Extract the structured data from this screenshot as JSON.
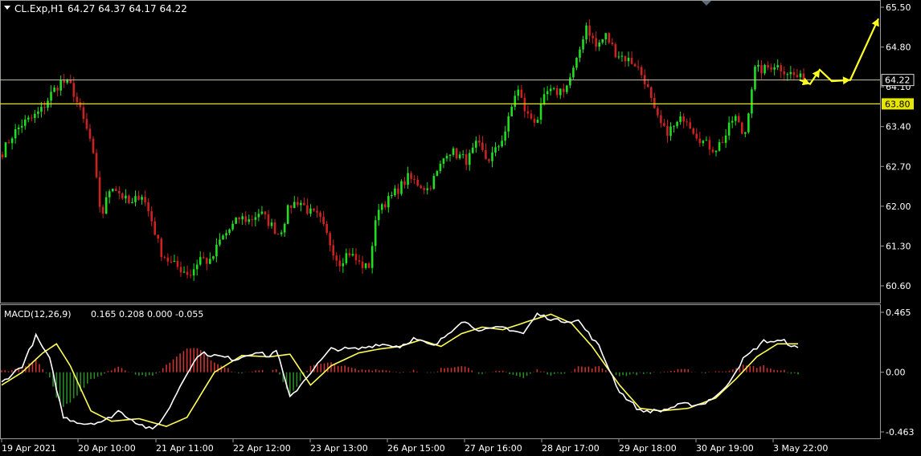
{
  "header": {
    "symbol": "CL.Exp,H1",
    "ohlc": "64.27 64.37 64.17 64.22"
  },
  "colors": {
    "background": "#000000",
    "bull_candle": "#22dd22",
    "bear_candle": "#cc2222",
    "level_line": "#e6e600",
    "current_price_line": "#c8c8a0",
    "macd_line": "#ffffff",
    "signal_line": "#ffff55",
    "hist_pos": "#cc3333",
    "hist_neg": "#2a8a2a",
    "axis_text": "#ffffff"
  },
  "chart_data": [
    {
      "type": "candlestick",
      "timeframe": "H1",
      "ylim": [
        60.3,
        65.55
      ],
      "y_ticks": [
        "65.50",
        "64.80",
        "64.10",
        "63.40",
        "62.70",
        "62.00",
        "61.30",
        "60.60"
      ],
      "x_ticks": [
        "19 Apr 2021",
        "20 Apr 10:00",
        "21 Apr 11:00",
        "22 Apr 12:00",
        "23 Apr 13:00",
        "26 Apr 15:00",
        "27 Apr 16:00",
        "28 Apr 17:00",
        "29 Apr 18:00",
        "30 Apr 19:00",
        "3 May 22:00"
      ],
      "current_price": {
        "value": 64.22,
        "label": "64.22"
      },
      "horizontal_level": {
        "value": 63.8,
        "label": "63.80"
      },
      "close_anchors": [
        [
          0,
          62.95
        ],
        [
          1,
          63.25
        ],
        [
          2,
          63.45
        ],
        [
          3,
          63.55
        ],
        [
          4,
          63.7
        ],
        [
          5,
          64.0
        ],
        [
          6,
          64.2
        ],
        [
          7,
          64.1
        ],
        [
          8,
          63.6
        ],
        [
          9,
          63.1
        ],
        [
          10,
          61.8
        ],
        [
          11,
          62.4
        ],
        [
          12,
          62.2
        ],
        [
          13,
          62.0
        ],
        [
          14,
          62.25
        ],
        [
          15,
          61.8
        ],
        [
          16,
          61.2
        ],
        [
          17,
          61.0
        ],
        [
          18,
          60.9
        ],
        [
          19,
          60.8
        ],
        [
          20,
          61.1
        ],
        [
          21,
          61.0
        ],
        [
          22,
          61.4
        ],
        [
          23,
          61.6
        ],
        [
          24,
          61.8
        ],
        [
          25,
          61.75
        ],
        [
          26,
          61.9
        ],
        [
          27,
          61.7
        ],
        [
          28,
          61.5
        ],
        [
          29,
          62.0
        ],
        [
          30,
          62.1
        ],
        [
          31,
          61.9
        ],
        [
          32,
          61.8
        ],
        [
          33,
          61.4
        ],
        [
          34,
          61.0
        ],
        [
          35,
          61.2
        ],
        [
          36,
          61.0
        ],
        [
          37,
          60.9
        ],
        [
          38,
          62.0
        ],
        [
          39,
          62.1
        ],
        [
          40,
          62.3
        ],
        [
          41,
          62.5
        ],
        [
          42,
          62.4
        ],
        [
          43,
          62.3
        ],
        [
          44,
          62.6
        ],
        [
          45,
          63.0
        ],
        [
          46,
          62.9
        ],
        [
          47,
          62.8
        ],
        [
          48,
          63.1
        ],
        [
          49,
          62.8
        ],
        [
          50,
          63.0
        ],
        [
          51,
          63.4
        ],
        [
          52,
          64.1
        ],
        [
          53,
          63.6
        ],
        [
          54,
          63.5
        ],
        [
          55,
          64.0
        ],
        [
          56,
          64.0
        ],
        [
          57,
          64.1
        ],
        [
          58,
          64.5
        ],
        [
          59,
          65.2
        ],
        [
          60,
          64.8
        ],
        [
          61,
          65.0
        ],
        [
          62,
          64.7
        ],
        [
          63,
          64.6
        ],
        [
          64,
          64.5
        ],
        [
          65,
          64.2
        ],
        [
          66,
          63.6
        ],
        [
          67,
          63.3
        ],
        [
          68,
          63.4
        ],
        [
          69,
          63.6
        ],
        [
          70,
          63.3
        ],
        [
          71,
          63.1
        ],
        [
          72,
          63.0
        ],
        [
          73,
          63.2
        ],
        [
          74,
          63.6
        ],
        [
          75,
          63.2
        ],
        [
          76,
          64.4
        ],
        [
          77,
          64.4
        ],
        [
          78,
          64.5
        ],
        [
          79,
          64.4
        ],
        [
          80,
          64.3
        ],
        [
          81,
          64.22
        ]
      ],
      "projection_arrow_path": [
        [
          64.22,
          0
        ],
        [
          64.15,
          1
        ],
        [
          64.4,
          2
        ],
        [
          64.2,
          3
        ],
        [
          64.22,
          4
        ],
        [
          65.3,
          5
        ]
      ]
    },
    {
      "type": "macd",
      "title": "MACD(12,26,9)",
      "values": "0.165 0.208 0.000 -0.055",
      "ylim": [
        -0.463,
        0.465
      ],
      "y_ticks": [
        "0.465",
        "0.00",
        "-0.463"
      ],
      "macd_anchors": [
        [
          0,
          -0.08
        ],
        [
          6,
          0.05
        ],
        [
          10,
          0.28
        ],
        [
          14,
          0.1
        ],
        [
          18,
          -0.35
        ],
        [
          24,
          -0.4
        ],
        [
          30,
          -0.38
        ],
        [
          34,
          -0.3
        ],
        [
          40,
          -0.4
        ],
        [
          44,
          -0.45
        ],
        [
          48,
          -0.32
        ],
        [
          54,
          0.0
        ],
        [
          58,
          0.15
        ],
        [
          64,
          0.12
        ],
        [
          68,
          0.1
        ],
        [
          74,
          0.16
        ],
        [
          78,
          0.12
        ],
        [
          80,
          0.18
        ],
        [
          84,
          -0.2
        ],
        [
          90,
          0.0
        ],
        [
          96,
          0.18
        ],
        [
          104,
          0.18
        ],
        [
          110,
          0.22
        ],
        [
          116,
          0.2
        ],
        [
          120,
          0.26
        ],
        [
          126,
          0.2
        ],
        [
          134,
          0.4
        ],
        [
          140,
          0.32
        ],
        [
          146,
          0.35
        ],
        [
          152,
          0.3
        ],
        [
          156,
          0.45
        ],
        [
          162,
          0.4
        ],
        [
          168,
          0.4
        ],
        [
          174,
          0.2
        ],
        [
          180,
          -0.15
        ],
        [
          186,
          -0.3
        ],
        [
          192,
          -0.3
        ],
        [
          198,
          -0.25
        ],
        [
          204,
          -0.25
        ],
        [
          210,
          -0.15
        ],
        [
          216,
          0.1
        ],
        [
          222,
          0.24
        ],
        [
          228,
          0.24
        ],
        [
          232,
          0.18
        ]
      ],
      "signal_anchors": [
        [
          0,
          -0.1
        ],
        [
          6,
          0.0
        ],
        [
          12,
          0.15
        ],
        [
          16,
          0.22
        ],
        [
          20,
          0.05
        ],
        [
          26,
          -0.3
        ],
        [
          32,
          -0.38
        ],
        [
          40,
          -0.36
        ],
        [
          48,
          -0.42
        ],
        [
          54,
          -0.35
        ],
        [
          62,
          0.0
        ],
        [
          70,
          0.13
        ],
        [
          78,
          0.12
        ],
        [
          84,
          0.14
        ],
        [
          90,
          -0.1
        ],
        [
          96,
          0.05
        ],
        [
          104,
          0.15
        ],
        [
          110,
          0.18
        ],
        [
          116,
          0.2
        ],
        [
          122,
          0.25
        ],
        [
          128,
          0.2
        ],
        [
          134,
          0.3
        ],
        [
          140,
          0.35
        ],
        [
          146,
          0.33
        ],
        [
          154,
          0.4
        ],
        [
          160,
          0.45
        ],
        [
          166,
          0.38
        ],
        [
          172,
          0.2
        ],
        [
          180,
          -0.1
        ],
        [
          186,
          -0.28
        ],
        [
          192,
          -0.3
        ],
        [
          200,
          -0.28
        ],
        [
          208,
          -0.2
        ],
        [
          214,
          -0.05
        ],
        [
          220,
          0.12
        ],
        [
          226,
          0.22
        ],
        [
          232,
          0.22
        ]
      ]
    }
  ]
}
